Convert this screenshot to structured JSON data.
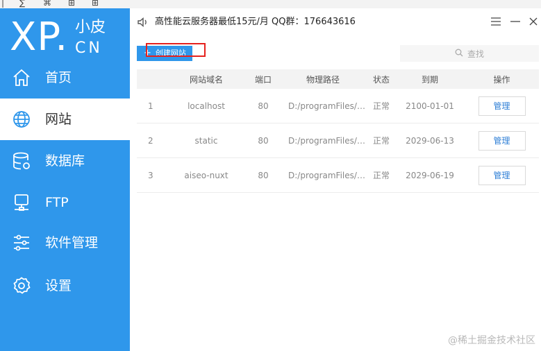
{
  "app": {
    "logo_main": "XP.",
    "logo_small": "小皮",
    "logo_cn": "CN"
  },
  "sidebar": {
    "items": [
      {
        "label": "首页",
        "icon": "home-icon"
      },
      {
        "label": "网站",
        "icon": "globe-icon",
        "active": true
      },
      {
        "label": "数据库",
        "icon": "database-icon"
      },
      {
        "label": "FTP",
        "icon": "ftp-server-icon"
      },
      {
        "label": "软件管理",
        "icon": "sliders-icon"
      },
      {
        "label": "设置",
        "icon": "gear-icon"
      }
    ]
  },
  "header": {
    "notice": "高性能云服务器最低15元/月 QQ群：176643616"
  },
  "toolbar": {
    "create_label": "创建网站",
    "search_placeholder": "查找"
  },
  "table": {
    "columns": [
      "网站域名",
      "端口",
      "物理路径",
      "状态",
      "到期",
      "操作"
    ],
    "rows": [
      {
        "index": "1",
        "domain": "localhost",
        "port": "80",
        "path": "D:/programFiles/p...",
        "status": "正常",
        "expiry": "2100-01-01",
        "action": "管理"
      },
      {
        "index": "2",
        "domain": "static",
        "port": "80",
        "path": "D:/programFiles/p...",
        "status": "正常",
        "expiry": "2029-06-13",
        "action": "管理"
      },
      {
        "index": "3",
        "domain": "aiseo-nuxt",
        "port": "80",
        "path": "D:/programFiles/p...",
        "status": "正常",
        "expiry": "2029-06-19",
        "action": "管理"
      }
    ]
  },
  "watermark": "@稀土掘金技术社区",
  "colors": {
    "sidebar_bg": "#2f97eb",
    "highlight": "#e5211d",
    "link": "#2f7fd6"
  }
}
